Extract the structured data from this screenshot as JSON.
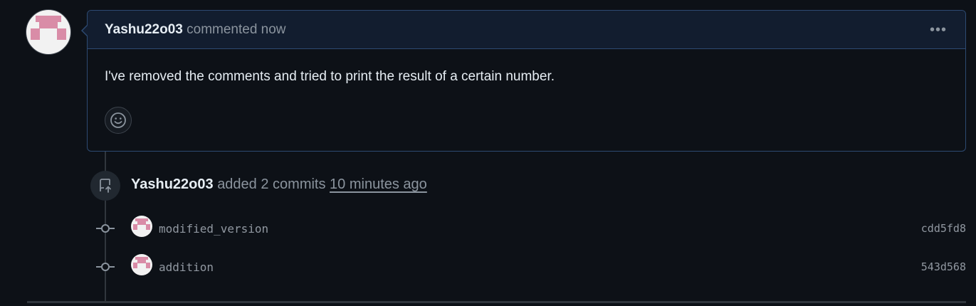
{
  "comment": {
    "author": "Yashu22o03",
    "action": "commented now",
    "body": "I've removed the comments and tried to print the result of a certain number.",
    "menu_glyph": "•••",
    "icons": [
      "identicon-avatar",
      "kebab-horizontal-icon",
      "smiley-icon"
    ]
  },
  "commit_event": {
    "author": "Yashu22o03",
    "action": "added 2 commits",
    "time": "10 minutes ago",
    "icon": "repo-push-icon"
  },
  "commits": [
    {
      "message": "modified_version",
      "sha": "cdd5fd8"
    },
    {
      "message": "addition",
      "sha": "543d568"
    }
  ],
  "colors": {
    "background": "#0d1117",
    "header_bg": "#121d2f",
    "border_accent": "#2d4a72",
    "muted_text": "#8b949e",
    "identicon": "#d98ca7"
  }
}
